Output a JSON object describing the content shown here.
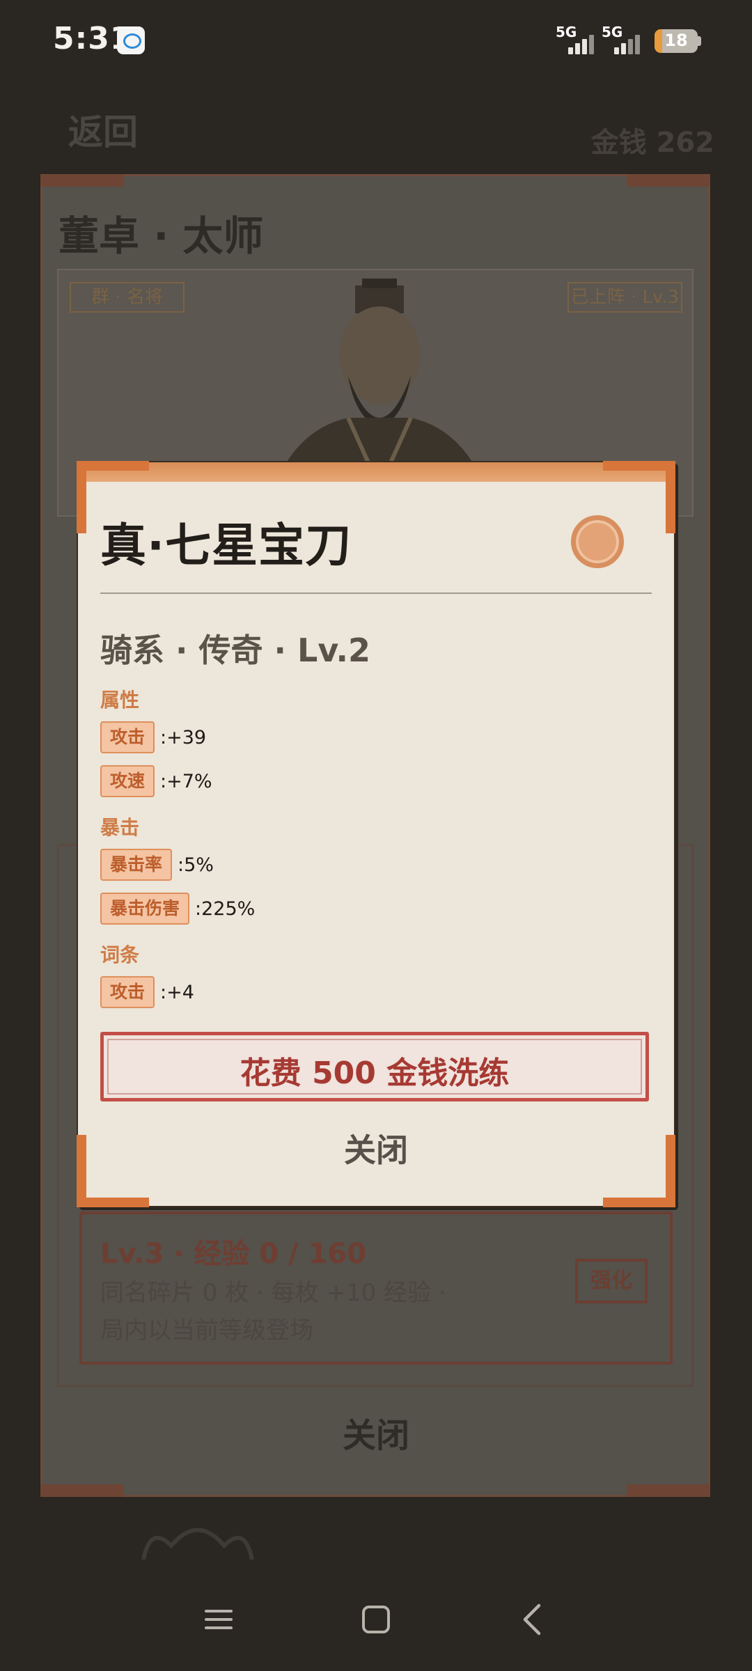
{
  "status_bar": {
    "time": "5:31",
    "network_1": "5G",
    "network_2": "5G",
    "battery": "18",
    "battery_level": 0.18,
    "app_icon": "messaging-app-icon"
  },
  "background_page": {
    "back_label": "返回",
    "money": "金钱 262",
    "hero_name": "董卓 · 太师",
    "faction_badge": "群 · 名将",
    "status_badge": "已上阵 · Lv.3",
    "level_title": "Lv.3 · 经验 0 / 160",
    "level_desc": "同名碎片 0 枚 · 每枚 +10 经验 · 局内以当前等级登场",
    "upgrade_label": "强化",
    "close_label": "关闭"
  },
  "modal": {
    "title": "真·七星宝刀",
    "subtitle": "骑系 · 传奇 · Lv.2",
    "coin_icon": "coin-icon",
    "sections": {
      "attributes": {
        "title": "属性",
        "rows": [
          {
            "tag": "攻击",
            "value": ":+39"
          },
          {
            "tag": "攻速",
            "value": ":+7%"
          }
        ]
      },
      "crit": {
        "title": "暴击",
        "rows": [
          {
            "tag": "暴击率",
            "value": ":5%"
          },
          {
            "tag": "暴击伤害",
            "value": ":225%"
          }
        ]
      },
      "affixes": {
        "title": "词条",
        "rows": [
          {
            "tag": "攻击",
            "value": ":+4"
          }
        ]
      }
    },
    "reforge_label": "花费 500 金钱洗练",
    "close_label": "关闭"
  },
  "nav_bar": {
    "recents_icon": "menu-lines-icon",
    "home_icon": "home-square-icon",
    "back_icon": "back-chevron-icon"
  },
  "colors": {
    "accent_orange": "#d8753a",
    "tag_bg": "#f4c4a3",
    "tag_text": "#bd5e2c",
    "button_red": "#c24f47",
    "modal_bg": "#ede6da",
    "overlay_bg": "#2a2621"
  }
}
